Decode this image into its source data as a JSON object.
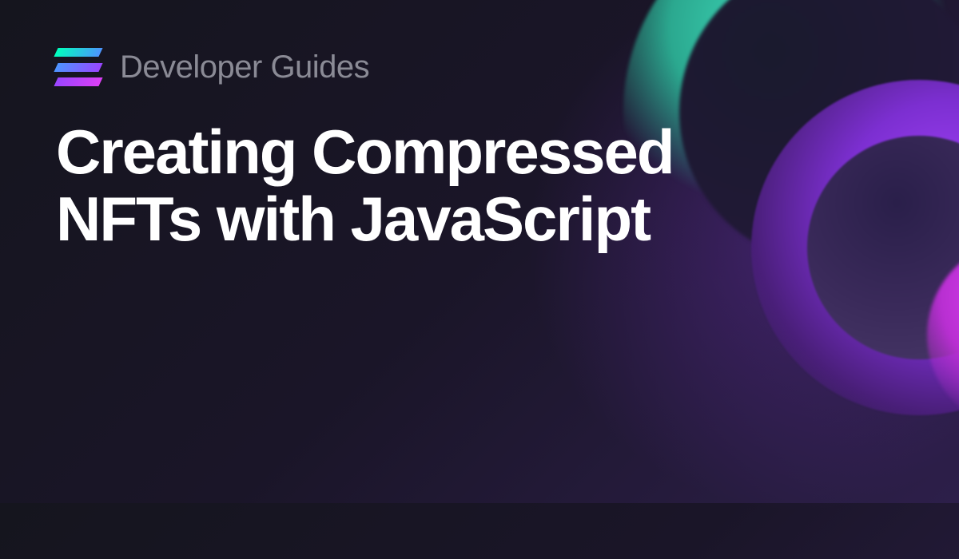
{
  "header": {
    "category": "Developer Guides"
  },
  "title": "Creating Compressed NFTs with JavaScript",
  "brand": {
    "logo_name": "solana-logo",
    "colors": {
      "gradient_start": "#00ffbd",
      "gradient_mid": "#4d94ff",
      "gradient_end": "#dc3ff5"
    }
  }
}
